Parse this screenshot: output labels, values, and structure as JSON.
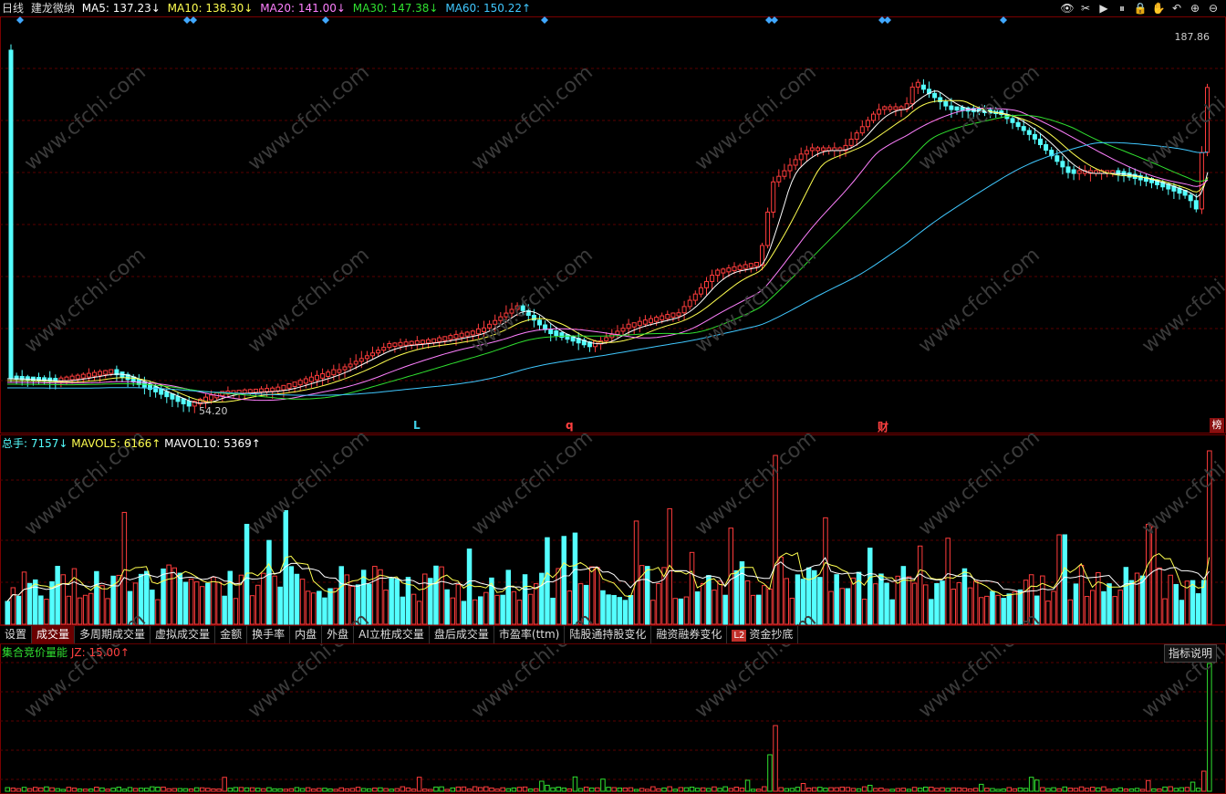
{
  "header": {
    "period": "日线",
    "stock_name": "建龙微纳",
    "ma5": "MA5: 137.23↓",
    "ma10": "MA10: 138.30↓",
    "ma20": "MA20: 141.00↓",
    "ma30": "MA30: 147.38↓",
    "ma60": "MA60: 150.22↑"
  },
  "toolbar": {
    "icons": [
      "eye-icon",
      "scissors-icon",
      "play-icon",
      "pause-icon",
      "lock-icon",
      "hand-icon",
      "undo-icon",
      "zoom-in-icon",
      "zoom-out-icon"
    ],
    "glyphs": [
      "👁",
      "✂",
      "▶",
      "⏸",
      "🔒",
      "✋",
      "↶",
      "⊕",
      "⊖"
    ]
  },
  "price_chart": {
    "high_label": "187.86",
    "low_label": "54.20",
    "markers": [
      {
        "text": "L",
        "color": "#3fd0e8"
      },
      {
        "text": "q",
        "color": "#ff4040"
      },
      {
        "text": "财",
        "color": "#ff4040"
      }
    ],
    "bang_label": "榜"
  },
  "volume_panel": {
    "total": "总手: 7157↓",
    "mavol5": "MAVOL5: 6166↑",
    "mavol10": "MAVOL10: 5369↑"
  },
  "tabs": [
    {
      "label": "设置",
      "active": false
    },
    {
      "label": "成交量",
      "active": true
    },
    {
      "label": "多周期成交量",
      "active": false
    },
    {
      "label": "虚拟成交量",
      "active": false
    },
    {
      "label": "金额",
      "active": false
    },
    {
      "label": "换手率",
      "active": false
    },
    {
      "label": "内盘",
      "active": false
    },
    {
      "label": "外盘",
      "active": false
    },
    {
      "label": "AI立桩成交量",
      "active": false
    },
    {
      "label": "盘后成交量",
      "active": false
    },
    {
      "label": "市盈率(ttm)",
      "active": false
    },
    {
      "label": "陆股通持股变化",
      "active": false
    },
    {
      "label": "融资融券变化",
      "active": false
    },
    {
      "label": "资金抄底",
      "active": false,
      "badge": "L2"
    }
  ],
  "auction_panel": {
    "title": "集合竞价量能",
    "jz": "JZ: 15.00↑",
    "help_button": "指标说明"
  },
  "watermark": "www.cfchi.com",
  "colors": {
    "up": "#ff3c3c",
    "down": "#54ffff",
    "ma5": "#ffffff",
    "ma10": "#ffff50",
    "ma20": "#ff80ff",
    "ma30": "#30e030",
    "ma60": "#40c8ff",
    "grid": "#7a0000"
  }
}
